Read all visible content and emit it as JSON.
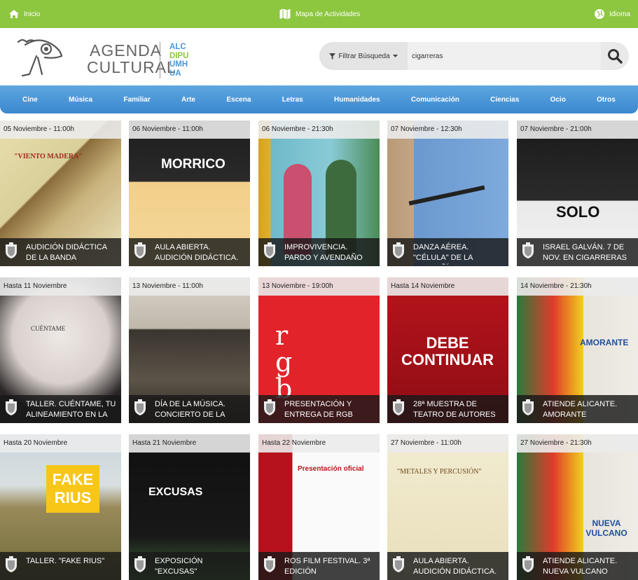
{
  "topbar": {
    "home_label": "Inicio",
    "map_label": "Mapa de Actividades",
    "language_label": "Idioma"
  },
  "logo": {
    "line1": "AGENDA",
    "line2": "CULTURAL",
    "city_lines": [
      "ALC",
      "DIPU",
      "UMH",
      "UA"
    ]
  },
  "search": {
    "filter_label": "Filtrar Búsqueda",
    "query": "cigarreras"
  },
  "nav": {
    "items": [
      "Cine",
      "Música",
      "Familiar",
      "Arte",
      "Escena",
      "Letras",
      "Humanidades",
      "Comunicación",
      "Ciencias",
      "Ocio",
      "Otros"
    ]
  },
  "colors": {
    "topbar": "#8dc63f",
    "nav": "#4a97d6",
    "card_footer": "#191919"
  },
  "events": [
    {
      "date": "05 Noviembre - 11:00h",
      "title": "AUDICIÓN DIDÁCTICA DE LA BANDA",
      "image_text": "\"VIENTO MADERA\""
    },
    {
      "date": "06 Noviembre - 11:00h",
      "title": "AULA ABIERTA. AUDICIÓN DIDÁCTICA.",
      "image_text": "MORRICO"
    },
    {
      "date": "06 Noviembre - 21:30h",
      "title": "IMPROVIVENCIA. PARDO Y AVENDAÑO",
      "image_text": ""
    },
    {
      "date": "07 Noviembre - 12:30h",
      "title": "DANZA AÉREA. \"CÉLULA\" DE LA COMPAÑÍA",
      "image_text": ""
    },
    {
      "date": "07 Noviembre - 21:00h",
      "title": "ISRAEL GALVÁN. 7 DE NOV. EN CIGARRERAS",
      "image_text": "SOLO"
    },
    {
      "date": "Hasta 11 Noviembre",
      "title": "TALLER. CUÉNTAME, TU ALINEAMIENTO EN LA",
      "image_text": "CUÉNTAME"
    },
    {
      "date": "13 Noviembre - 11:00h",
      "title": "DÍA DE LA MÚSICA. CONCIERTO DE LA",
      "image_text": ""
    },
    {
      "date": "13 Noviembre - 19:00h",
      "title": "PRESENTACIÓN Y ENTREGA DE RGB",
      "image_text": "rgb"
    },
    {
      "date": "Hasta 14 Noviembre",
      "title": "28ª MUESTRA DE TEATRO DE AUTORES",
      "image_text": "DEBE CONTINUAR"
    },
    {
      "date": "14 Noviembre - 21:30h",
      "title": "ATIENDE ALICANTE. AMORANTE",
      "image_text": "AMORANTE"
    },
    {
      "date": "Hasta 20 Noviembre",
      "title": "TALLER. \"FAKE RIUS\"",
      "image_text": "FAKE RIUS"
    },
    {
      "date": "Hasta 21 Noviembre",
      "title": "EXPOSICIÓN \"EXCUSAS\"",
      "image_text": "EXCUSAS"
    },
    {
      "date": "Hasta 22 Noviembre",
      "title": "ROS FILM FESTIVAL. 3ª EDICIÓN",
      "image_text": "Presentación oficial"
    },
    {
      "date": "27 Noviembre - 11:00h",
      "title": "AULA ABIERTA. AUDICIÓN DIDÁCTICA.",
      "image_text": "\"METALES Y PERCUSIÓN\""
    },
    {
      "date": "27 Noviembre - 21:30h",
      "title": "ATIENDE ALICANTE. NUEVA VULCANO",
      "image_text": "NUEVA VULCANO"
    }
  ]
}
